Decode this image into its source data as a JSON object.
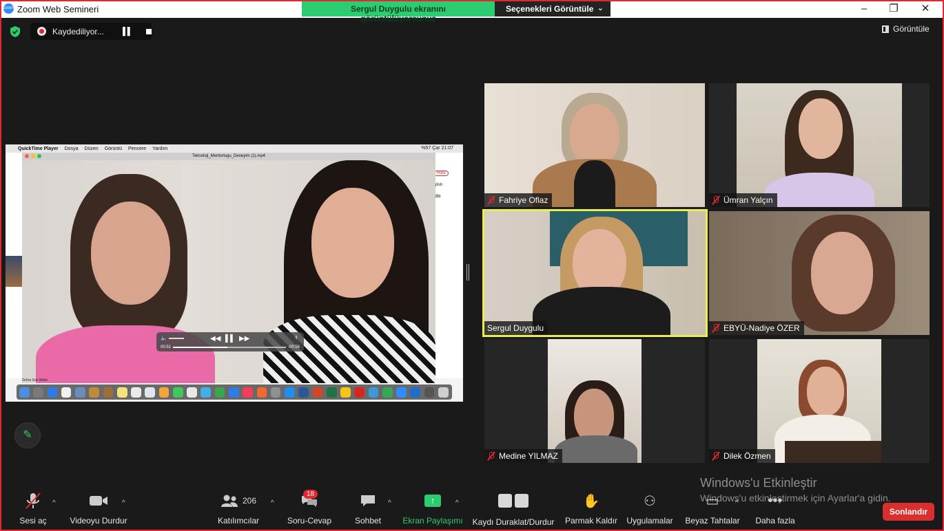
{
  "window": {
    "title": "Zoom Web Semineri",
    "logo_text": "zoom",
    "controls": [
      "–",
      "❐",
      "✕"
    ]
  },
  "share_banner": {
    "status": "Sergul Duygulu ekranını görüntülüyorsunuz",
    "options": "Seçenekleri Görüntüle"
  },
  "recording": {
    "status": "Kaydediliyor..."
  },
  "view_button": "Görüntüle",
  "shared_screen": {
    "menubar": [
      "QuickTime Player",
      "Dosya",
      "Düzen",
      "Görüntü",
      "Pencere",
      "Yardım"
    ],
    "menubar_right": "%57  Çar 21:07",
    "player_title": "Teknoloji_Mentorlugu_Deneyim (1).mp4",
    "time_elapsed": "00:51",
    "time_remaining": "-00:56",
    "caption": "Zehra Gok Metin",
    "browser_snippets": [
      "Hata",
      "glish",
      "zda"
    ],
    "playback_progress": 0.48
  },
  "participants": [
    {
      "name": "Fahriye Oflaz",
      "muted": true
    },
    {
      "name": "Ümran Yalçın",
      "muted": true
    },
    {
      "name": "Sergul Duygulu",
      "muted": false,
      "active_speaker": true
    },
    {
      "name": "EBYÜ-Nadiye ÖZER",
      "muted": true
    },
    {
      "name": "Medine YILMAZ",
      "muted": true
    },
    {
      "name": "Dilek Özmen",
      "muted": true
    }
  ],
  "watermark": {
    "title": "Windows'u Etkinleştir",
    "subtitle": "Windows'u etkinleştirmek için Ayarlar'a gidin."
  },
  "toolbar": {
    "unmute": "Sesi aç",
    "stop_video": "Videoyu Durdur",
    "participants": "Katılımcılar",
    "participants_count": "206",
    "qa": "Soru-Cevap",
    "qa_badge": "18",
    "chat": "Sohbet",
    "share_screen": "Ekran Paylaşımı",
    "pause_record": "Kaydı Duraklat/Durdur",
    "raise_hand": "Parmak Kaldır",
    "apps": "Uygulamalar",
    "whiteboard": "Beyaz Tahtalar",
    "more": "Daha fazla",
    "end": "Sonlandır"
  },
  "colors": {
    "accent_green": "#2ecc71",
    "end_red": "#d92f2f",
    "active_speaker": "#e9ee4e",
    "frame_red": "#e0282e"
  }
}
